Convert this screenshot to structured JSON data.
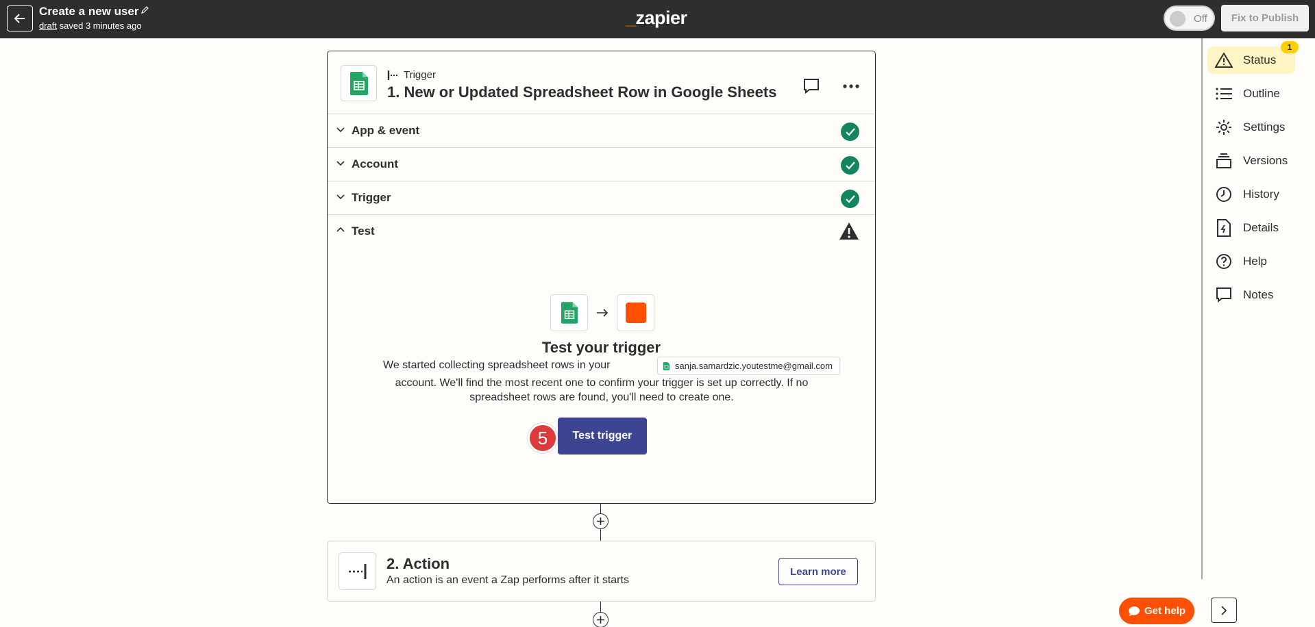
{
  "header": {
    "title": "Create a new user",
    "draft_link": "draft",
    "saved_text": "saved 3 minutes ago",
    "logo_text": "zapier",
    "toggle_label": "Off",
    "publish_label": "Fix to Publish"
  },
  "sidebar": {
    "badge": "1",
    "items": [
      {
        "label": "Status",
        "icon": "warning-icon"
      },
      {
        "label": "Outline",
        "icon": "list-icon"
      },
      {
        "label": "Settings",
        "icon": "gear-icon"
      },
      {
        "label": "Versions",
        "icon": "versions-icon"
      },
      {
        "label": "History",
        "icon": "clock-icon"
      },
      {
        "label": "Details",
        "icon": "bolt-file-icon"
      },
      {
        "label": "Help",
        "icon": "question-icon"
      },
      {
        "label": "Notes",
        "icon": "comment-icon"
      }
    ],
    "help_button": "Get help"
  },
  "trigger_step": {
    "kicker": "Trigger",
    "title": "1. New or Updated Spreadsheet Row in Google Sheets",
    "sections": [
      {
        "label": "App & event",
        "status": "complete"
      },
      {
        "label": "Account",
        "status": "complete"
      },
      {
        "label": "Trigger",
        "status": "complete"
      },
      {
        "label": "Test",
        "status": "warning"
      }
    ],
    "test": {
      "title": "Test your trigger",
      "desc_prefix": "We started collecting spreadsheet rows in your",
      "account_email": "sanja.samardzic.youtestme@gmail.com",
      "desc_suffix": "account. We'll find the most recent one to confirm your trigger is set up correctly. If no spreadsheet rows are found, you'll need to create one.",
      "step_number": "5",
      "button_label": "Test trigger"
    }
  },
  "action_step": {
    "title": "2. Action",
    "description": "An action is an event a Zap performs after it starts",
    "learn_more": "Learn more"
  },
  "colors": {
    "topbar": "#2d2e2e",
    "brand": "#ff4f00",
    "primary": "#3d4592",
    "success": "#13855e",
    "sheets_green": "#23a566"
  }
}
